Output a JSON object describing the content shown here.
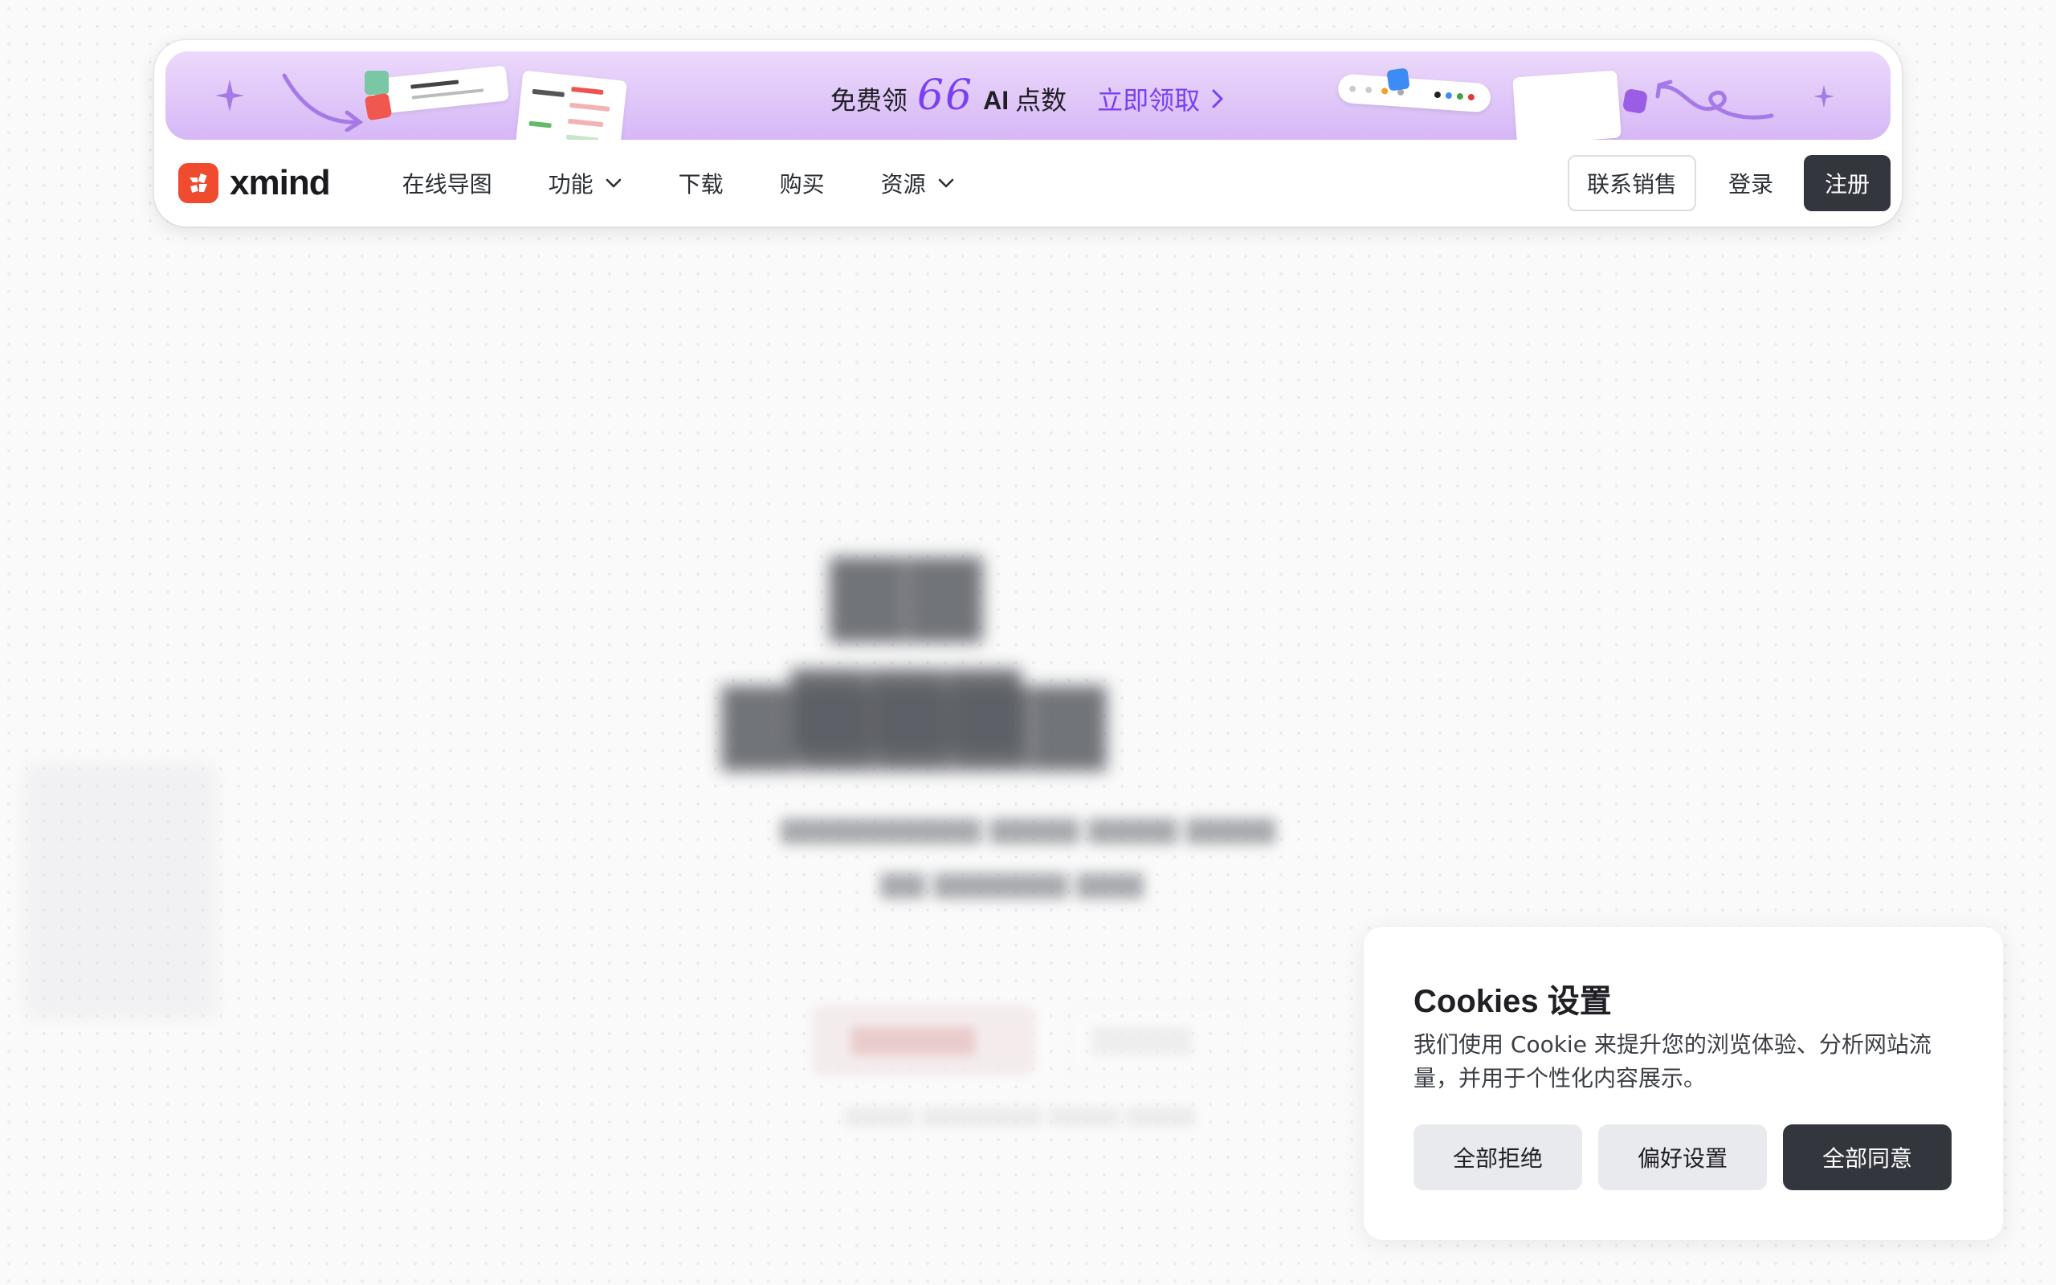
{
  "promo": {
    "prefix": "免费领",
    "number": "66",
    "ai": "AI",
    "suffix": "点数",
    "link_label": "立即领取"
  },
  "brand": {
    "name": "xmind",
    "color": "#f04a2f"
  },
  "nav": {
    "items": [
      {
        "label": "在线导图",
        "has_dropdown": false
      },
      {
        "label": "功能",
        "has_dropdown": true
      },
      {
        "label": "下载",
        "has_dropdown": false
      },
      {
        "label": "购买",
        "has_dropdown": false
      },
      {
        "label": "资源",
        "has_dropdown": true
      }
    ],
    "contact_sales": "联系销售",
    "login": "登录",
    "signup": "注册"
  },
  "cookie": {
    "title": "Cookies 设置",
    "description": "我们使用 Cookie 来提升您的浏览体验、分析网站流量，并用于个性化内容展示。",
    "reject_all": "全部拒绝",
    "preferences": "偏好设置",
    "accept_all": "全部同意"
  },
  "colors": {
    "accent_purple": "#7b3ff2",
    "dark_button": "#33373d",
    "banner_gradient_top": "#ecd9fb",
    "banner_gradient_bottom": "#d6b8f6"
  }
}
